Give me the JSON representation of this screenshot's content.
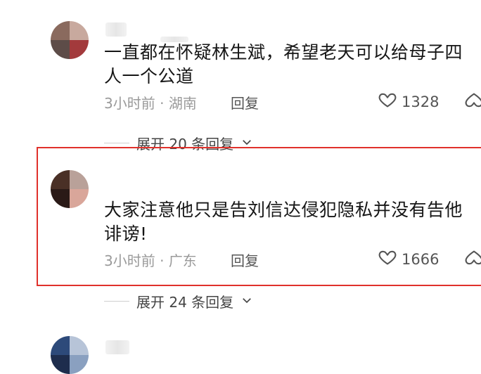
{
  "comments": [
    {
      "text": "一直都在怀疑林生斌，希望老天可以给母子四人一个公道",
      "time": "3小时前",
      "location": "湖南",
      "reply_label": "回复",
      "likes": "1328",
      "expand_label": "展开 20 条回复"
    },
    {
      "text": "大家注意他只是告刘信达侵犯隐私并没有告他诽谤!",
      "time": "3小时前",
      "location": "广东",
      "reply_label": "回复",
      "likes": "1666",
      "expand_label": "展开 24 条回复"
    }
  ],
  "meta_separator": "·",
  "colors": {
    "highlight": "#e0312b",
    "meta": "#9a9a9a",
    "text": "#161616"
  },
  "icons": [
    "heart-outline-icon",
    "dislike-icon",
    "chevron-down-icon"
  ]
}
